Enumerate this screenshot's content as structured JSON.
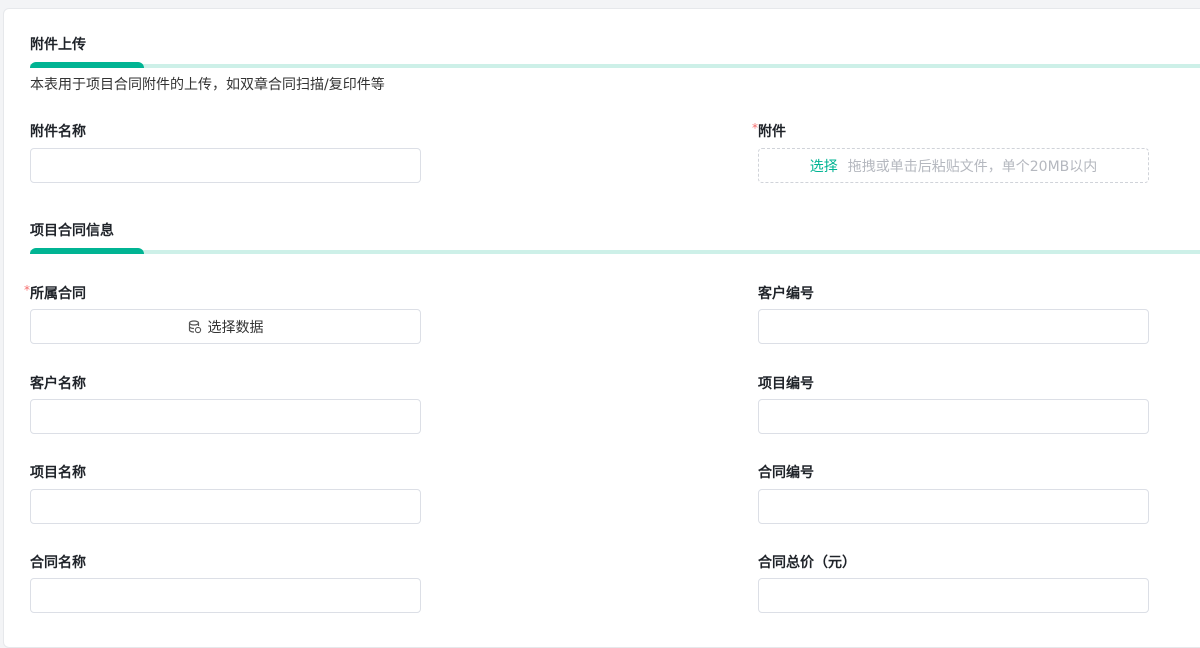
{
  "section1": {
    "title": "附件上传",
    "description": "本表用于项目合同附件的上传，如双章合同扫描/复印件等",
    "attachment_name_label": "附件名称",
    "attachment_name_value": "",
    "attachment_label": "附件",
    "required_mark": "*",
    "upload_select": "选择",
    "upload_hint": "拖拽或单击后粘贴文件，单个20MB以内"
  },
  "section2": {
    "title": "项目合同信息",
    "contract_label": "所属合同",
    "required_mark": "*",
    "select_data": "选择数据",
    "fields": {
      "customer_no": "客户编号",
      "customer_name": "客户名称",
      "project_no": "项目编号",
      "project_name": "项目名称",
      "contract_no": "合同编号",
      "contract_name": "合同名称",
      "contract_total": "合同总价（元）"
    }
  },
  "colors": {
    "accent": "#00b493",
    "accent_light": "#cdf0e8",
    "required": "#f56c6c"
  }
}
